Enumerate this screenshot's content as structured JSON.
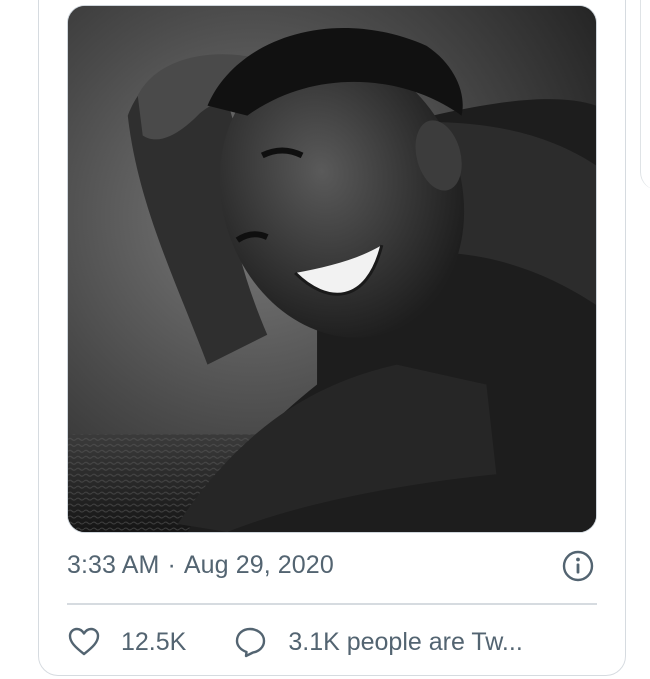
{
  "tweet": {
    "media_alt": "Black and white portrait of a smiling man resting his head on his hand",
    "time": "3:33 AM",
    "separator": "·",
    "date": "Aug 29, 2020",
    "info_icon": "info-icon",
    "like_icon": "heart-icon",
    "like_count": "12.5K",
    "reply_icon": "speech-bubble-icon",
    "reply_label": "3.1K people are Tw..."
  }
}
